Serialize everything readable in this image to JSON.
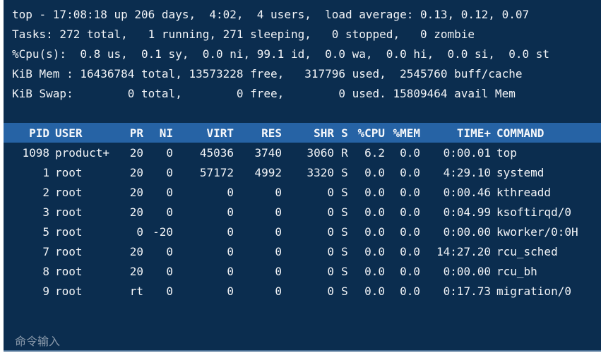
{
  "summary": {
    "line1": "top - 17:08:18 up 206 days,  4:02,  4 users,  load average: 0.13, 0.12, 0.07",
    "line2": "Tasks: 272 total,   1 running, 271 sleeping,   0 stopped,   0 zombie",
    "line3": "%Cpu(s):  0.8 us,  0.1 sy,  0.0 ni, 99.1 id,  0.0 wa,  0.0 hi,  0.0 si,  0.0 st",
    "line4": "KiB Mem : 16436784 total, 13573228 free,   317796 used,  2545760 buff/cache",
    "line5": "KiB Swap:        0 total,        0 free,        0 used. 15809464 avail Mem"
  },
  "table": {
    "headers": {
      "pid": "PID",
      "user": "USER",
      "pr": "PR",
      "ni": "NI",
      "virt": "VIRT",
      "res": "RES",
      "shr": "SHR",
      "s": "S",
      "cpu": "%CPU",
      "mem": "%MEM",
      "time": "TIME+",
      "command": "COMMAND"
    },
    "rows": [
      {
        "pid": "1098",
        "user": "product+",
        "pr": "20",
        "ni": "0",
        "virt": "45036",
        "res": "3740",
        "shr": "3060",
        "s": "R",
        "cpu": "6.2",
        "mem": "0.0",
        "time": "0:00.01",
        "command": "top"
      },
      {
        "pid": "1",
        "user": "root",
        "pr": "20",
        "ni": "0",
        "virt": "57172",
        "res": "4992",
        "shr": "3320",
        "s": "S",
        "cpu": "0.0",
        "mem": "0.0",
        "time": "4:29.10",
        "command": "systemd"
      },
      {
        "pid": "2",
        "user": "root",
        "pr": "20",
        "ni": "0",
        "virt": "0",
        "res": "0",
        "shr": "0",
        "s": "S",
        "cpu": "0.0",
        "mem": "0.0",
        "time": "0:00.46",
        "command": "kthreadd"
      },
      {
        "pid": "3",
        "user": "root",
        "pr": "20",
        "ni": "0",
        "virt": "0",
        "res": "0",
        "shr": "0",
        "s": "S",
        "cpu": "0.0",
        "mem": "0.0",
        "time": "0:04.99",
        "command": "ksoftirqd/0"
      },
      {
        "pid": "5",
        "user": "root",
        "pr": "0",
        "ni": "-20",
        "virt": "0",
        "res": "0",
        "shr": "0",
        "s": "S",
        "cpu": "0.0",
        "mem": "0.0",
        "time": "0:00.00",
        "command": "kworker/0:0H"
      },
      {
        "pid": "7",
        "user": "root",
        "pr": "20",
        "ni": "0",
        "virt": "0",
        "res": "0",
        "shr": "0",
        "s": "S",
        "cpu": "0.0",
        "mem": "0.0",
        "time": "14:27.20",
        "command": "rcu_sched"
      },
      {
        "pid": "8",
        "user": "root",
        "pr": "20",
        "ni": "0",
        "virt": "0",
        "res": "0",
        "shr": "0",
        "s": "S",
        "cpu": "0.0",
        "mem": "0.0",
        "time": "0:00.00",
        "command": "rcu_bh"
      },
      {
        "pid": "9",
        "user": "root",
        "pr": "rt",
        "ni": "0",
        "virt": "0",
        "res": "0",
        "shr": "0",
        "s": "S",
        "cpu": "0.0",
        "mem": "0.0",
        "time": "0:17.73",
        "command": "migration/0"
      }
    ]
  },
  "command_input": {
    "placeholder": "命令输入"
  },
  "colors": {
    "terminal_bg": "#0b2d4f",
    "header_bg": "#2663a5",
    "text": "#f2f4f7",
    "placeholder": "#8b9aab"
  }
}
